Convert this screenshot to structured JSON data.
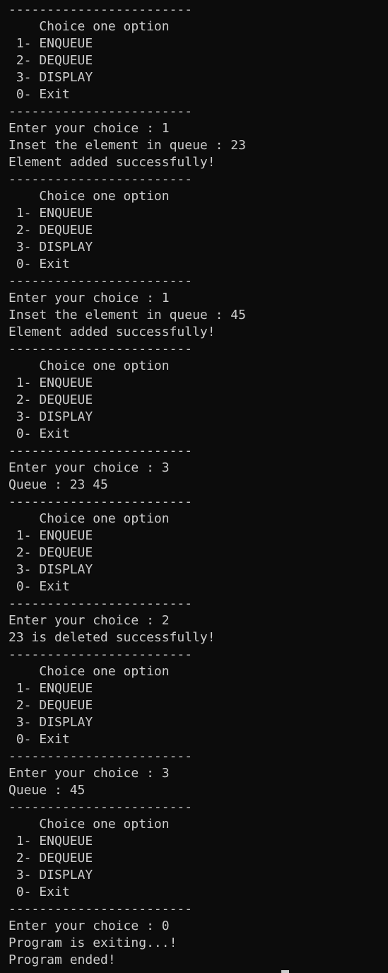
{
  "terminal": {
    "lines": [
      "------------------------",
      "    Choice one option",
      " 1- ENQUEUE",
      " 2- DEQUEUE",
      " 3- DISPLAY",
      " 0- Exit",
      "------------------------",
      "Enter your choice : 1",
      "Inset the element in queue : 23",
      "Element added successfully!",
      "------------------------",
      "    Choice one option",
      " 1- ENQUEUE",
      " 2- DEQUEUE",
      " 3- DISPLAY",
      " 0- Exit",
      "------------------------",
      "Enter your choice : 1",
      "Inset the element in queue : 45",
      "Element added successfully!",
      "------------------------",
      "    Choice one option",
      " 1- ENQUEUE",
      " 2- DEQUEUE",
      " 3- DISPLAY",
      " 0- Exit",
      "------------------------",
      "Enter your choice : 3",
      "Queue : 23 45",
      "------------------------",
      "    Choice one option",
      " 1- ENQUEUE",
      " 2- DEQUEUE",
      " 3- DISPLAY",
      " 0- Exit",
      "------------------------",
      "Enter your choice : 2",
      "23 is deleted successfully!",
      "------------------------",
      "    Choice one option",
      " 1- ENQUEUE",
      " 2- DEQUEUE",
      " 3- DISPLAY",
      " 0- Exit",
      "------------------------",
      "Enter your choice : 3",
      "Queue : 45",
      "------------------------",
      "    Choice one option",
      " 1- ENQUEUE",
      " 2- DEQUEUE",
      " 3- DISPLAY",
      " 0- Exit",
      "------------------------",
      "Enter your choice : 0",
      "Program is exiting...!",
      "Program ended!"
    ],
    "colors": {
      "background": "#0c0c0c",
      "foreground": "#cccccc"
    }
  }
}
